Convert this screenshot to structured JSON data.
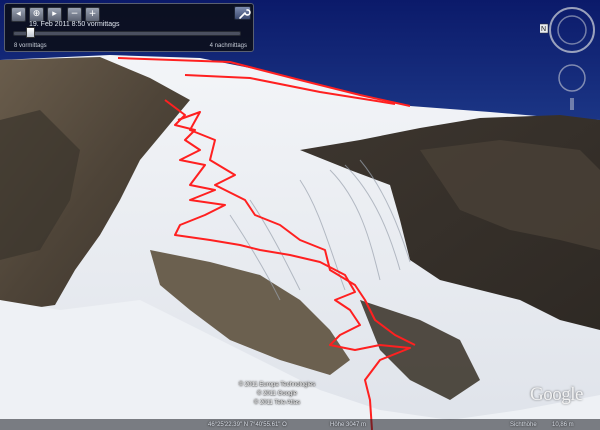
{
  "time_slider": {
    "date": "19. Feb 2011  8:50 vormittags",
    "range_start": "8 vormittags",
    "range_end": "4 nachmittags",
    "position_fraction": 0.06,
    "buttons": {
      "back": "◂",
      "zoom_add": "⊕",
      "forward": "▸",
      "zoom_out": "−",
      "zoom_in": "+"
    }
  },
  "map": {
    "credits": [
      "© 2011 Europa Technologies",
      "© 2011 Google",
      "© 2011 Tele Atlas"
    ],
    "logo": "Google",
    "track_color": "#ff2020",
    "sky_color": "#1e3a8a"
  },
  "status_bar": {
    "coordinates": "46°25'22.39\" N    7°40'55.61\" O",
    "elevation": "Höhe  3047 m",
    "eye_alt_label": "Sichthöhe",
    "eye_alt_value": "10,86 m"
  }
}
